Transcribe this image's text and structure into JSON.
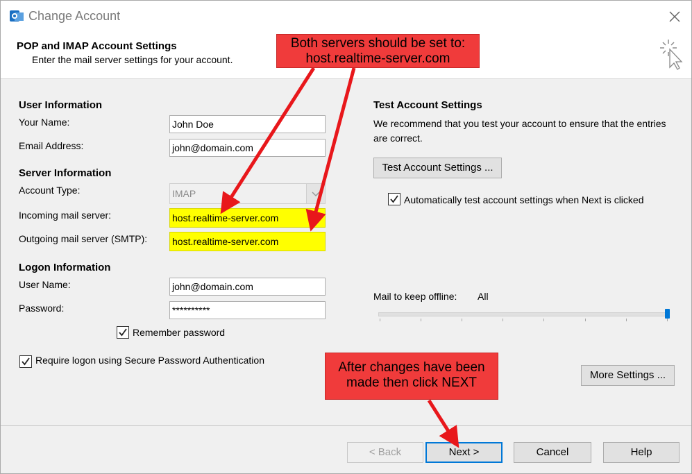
{
  "window": {
    "title": "Change Account"
  },
  "header": {
    "title": "POP and IMAP Account Settings",
    "subtitle": "Enter the mail server settings for your account."
  },
  "user_info": {
    "section": "User Information",
    "name_label": "Your Name:",
    "name_value": "John Doe",
    "email_label": "Email Address:",
    "email_value": "john@domain.com"
  },
  "server_info": {
    "section": "Server Information",
    "account_type_label": "Account Type:",
    "account_type_value": "IMAP",
    "incoming_label": "Incoming mail server:",
    "incoming_value": "host.realtime-server.com",
    "outgoing_label": "Outgoing mail server (SMTP):",
    "outgoing_value": "host.realtime-server.com"
  },
  "logon_info": {
    "section": "Logon Information",
    "username_label": "User Name:",
    "username_value": "john@domain.com",
    "password_label": "Password:",
    "password_value": "**********",
    "remember_label": "Remember password",
    "remember_checked": true,
    "spa_label": "Require logon using Secure Password Authentication",
    "spa_checked": true
  },
  "test_settings": {
    "section": "Test Account Settings",
    "description": "We recommend that you test your account to ensure that the entries are correct.",
    "button": "Test Account Settings ...",
    "auto_test_label": "Automatically test account settings when Next is clicked",
    "auto_test_checked": true
  },
  "offline": {
    "label": "Mail to keep offline:",
    "value": "All",
    "slider_level": 1.0
  },
  "more_settings_button": "More Settings ...",
  "footer": {
    "back": "< Back",
    "next": "Next >",
    "cancel": "Cancel",
    "help": "Help"
  },
  "annotations": {
    "top_callout_line1": "Both servers should be set to:",
    "top_callout_line2": "host.realtime-server.com",
    "bottom_callout_line1": "After changes have been",
    "bottom_callout_line2": "made then click NEXT"
  },
  "colors": {
    "highlight": "#ffff00",
    "callout": "#f03b3b",
    "arrow": "#e8171b",
    "accent": "#0078d7"
  }
}
